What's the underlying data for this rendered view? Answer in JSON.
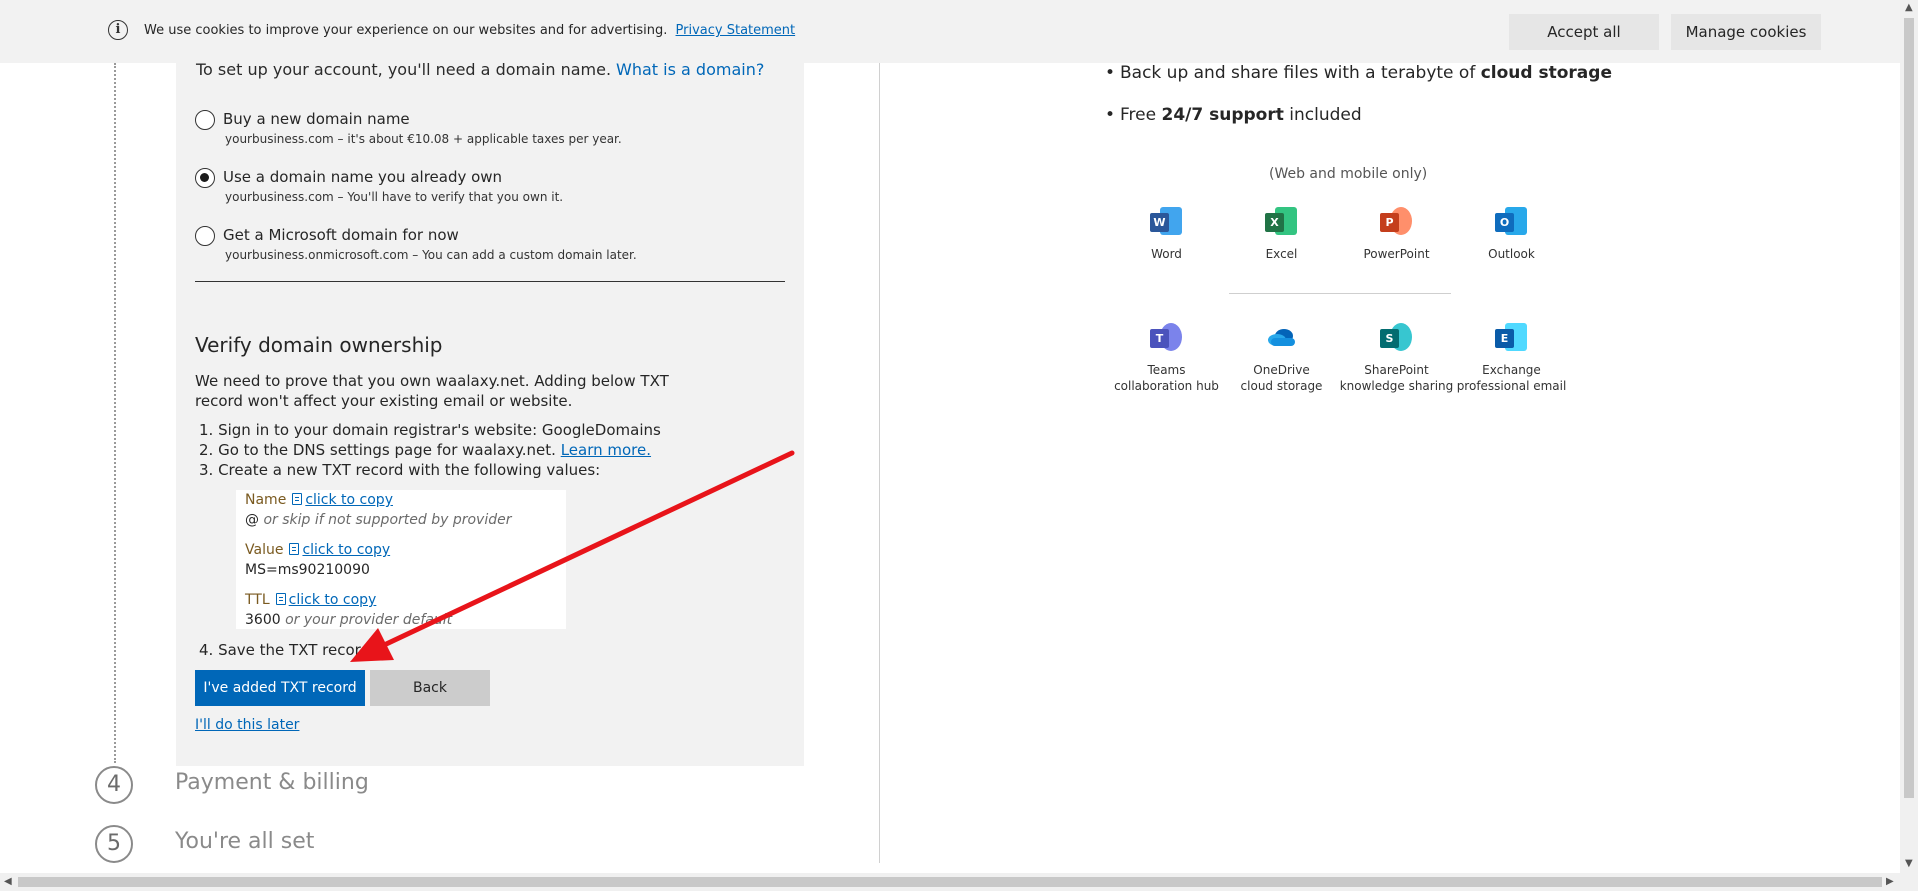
{
  "cookie_banner": {
    "text": "We use cookies to improve your experience on our websites and for advertising.",
    "privacy_link": "Privacy Statement",
    "accept_label": "Accept all",
    "manage_label": "Manage cookies",
    "info_icon": "i"
  },
  "domain_setup": {
    "intro": "To set up your account, you'll need a domain name.",
    "what_is_link": "What is a domain?",
    "options": [
      {
        "label": "Buy a new domain name",
        "sub": "yourbusiness.com – it's about €10.08 + applicable taxes per year.",
        "selected": false
      },
      {
        "label": "Use a domain name you already own",
        "sub": "yourbusiness.com – You'll have to verify that you own it.",
        "selected": true
      },
      {
        "label": "Get a Microsoft domain for now",
        "sub": "yourbusiness.onmicrosoft.com – You can add a custom domain later.",
        "selected": false
      }
    ]
  },
  "verify": {
    "title": "Verify domain ownership",
    "description": "We need to prove that you own waalaxy.net. Adding below TXT record won't affect your existing email or website.",
    "step1": "1. Sign in to your domain registrar's website: GoogleDomains",
    "step2_prefix": "2. Go to the DNS settings page for waalaxy.net.",
    "step2_link": "Learn more.",
    "step3": "3. Create a new TXT record with the following values:",
    "step4": "4. Save the TXT record.",
    "record": {
      "name_label": "Name",
      "name_value": "@",
      "name_hint": "or skip if not supported by provider",
      "value_label": "Value",
      "value_value": "MS=ms90210090",
      "ttl_label": "TTL",
      "ttl_value": "3600",
      "ttl_hint": "or your provider default",
      "copy_label": "click to copy"
    },
    "primary_button": "I've added TXT record",
    "back_button": "Back",
    "later_link": "I'll do this later"
  },
  "steps": [
    {
      "number": "4",
      "title": "Payment & billing"
    },
    {
      "number": "5",
      "title": "You're all set"
    }
  ],
  "features": {
    "bullet1_prefix": "Back up and share files with a terabyte of",
    "bullet1_bold": "cloud storage",
    "bullet2_prefix": "Free",
    "bullet2_bold": "24/7 support",
    "bullet2_suffix": "included",
    "note": "(Web and mobile only)",
    "apps_row1": [
      {
        "name": "Word",
        "icon": "word-icon",
        "letter": "W",
        "color": "#2b579a",
        "back": "#41a5ee"
      },
      {
        "name": "Excel",
        "icon": "excel-icon",
        "letter": "X",
        "color": "#217346",
        "back": "#33c481"
      },
      {
        "name": "PowerPoint",
        "icon": "powerpoint-icon",
        "letter": "P",
        "color": "#c43e1c",
        "back": "#ff8f6b"
      },
      {
        "name": "Outlook",
        "icon": "outlook-icon",
        "letter": "O",
        "color": "#0f6cbd",
        "back": "#28a8ea"
      }
    ],
    "apps_row2": [
      {
        "name1": "Teams",
        "name2": "collaboration hub",
        "icon": "teams-icon",
        "letter": "T",
        "color": "#4b53bc",
        "back": "#7b83eb"
      },
      {
        "name1": "OneDrive",
        "name2": "cloud storage",
        "icon": "onedrive-icon",
        "letter": "",
        "color": "#0364b8",
        "back": "#28a8ea"
      },
      {
        "name1": "SharePoint",
        "name2": "knowledge sharing",
        "icon": "sharepoint-icon",
        "letter": "S",
        "color": "#036c70",
        "back": "#37c6d0"
      },
      {
        "name1": "Exchange",
        "name2": "professional email",
        "icon": "exchange-icon",
        "letter": "E",
        "color": "#0a5ba8",
        "back": "#50d9ff"
      }
    ]
  }
}
